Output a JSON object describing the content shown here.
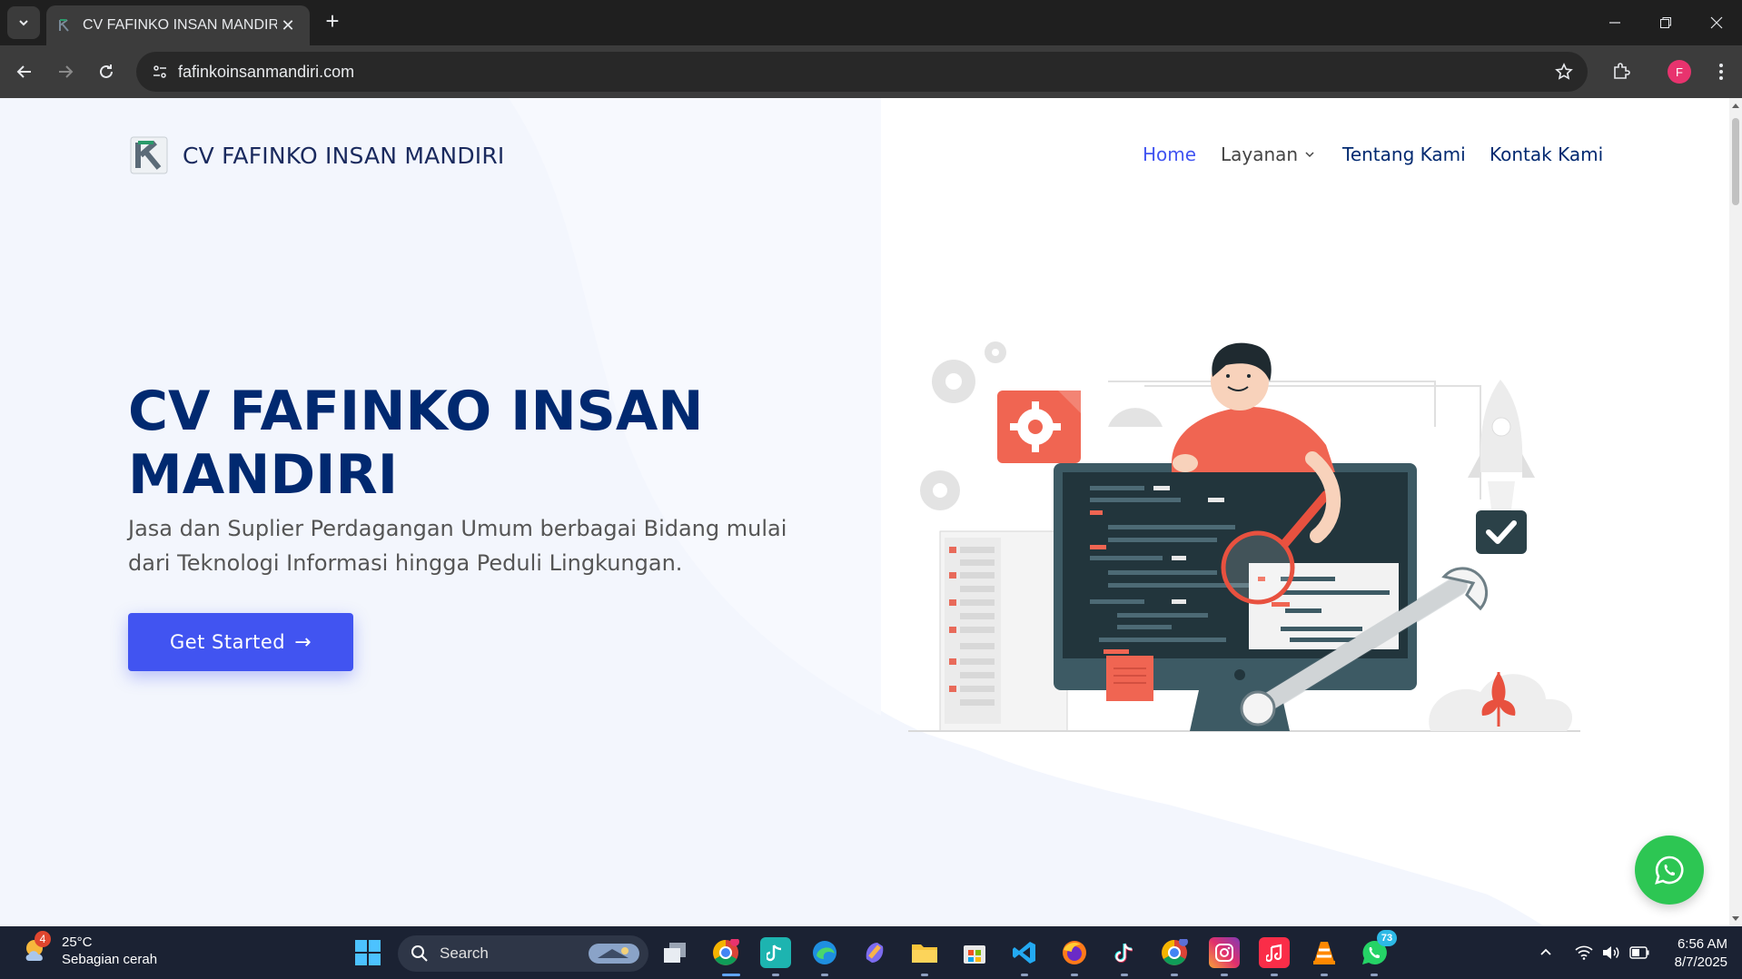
{
  "browser": {
    "tab_title": "CV FAFINKO INSAN MANDIRI",
    "url": "fafinkoinsanmandiri.com",
    "profile_initial": "F"
  },
  "site": {
    "brand_name": "CV FAFINKO INSAN MANDIRI",
    "nav": {
      "home": "Home",
      "layanan": "Layanan",
      "tentang": "Tentang Kami",
      "kontak": "Kontak Kami"
    },
    "hero": {
      "title": "CV FAFINKO INSAN MANDIRI",
      "subtitle": "Jasa dan Suplier Perdagangan Umum berbagai Bidang mulai dari Teknologi Informasi hingga Peduli Lingkungan.",
      "cta_label": "Get Started"
    },
    "colors": {
      "primary": "#4154f1",
      "heading": "#012970",
      "whatsapp": "#2dc653"
    }
  },
  "taskbar": {
    "weather": {
      "temp": "25°C",
      "desc": "Sebagian cerah",
      "badge": "4"
    },
    "search_label": "Search",
    "clock": {
      "time": "6:56 AM",
      "date": "8/7/2025"
    },
    "whatsapp_badge": "73",
    "pinned_apps": [
      "file-explorer-icon",
      "chrome-icon",
      "tiktok-music-icon",
      "edge-icon",
      "copilot-icon",
      "folder-icon",
      "store-icon",
      "vscode-icon",
      "firefox-icon",
      "tiktok-icon",
      "chrome-profile-icon",
      "instagram-icon",
      "apple-music-icon",
      "vlc-icon",
      "whatsapp-icon"
    ]
  }
}
